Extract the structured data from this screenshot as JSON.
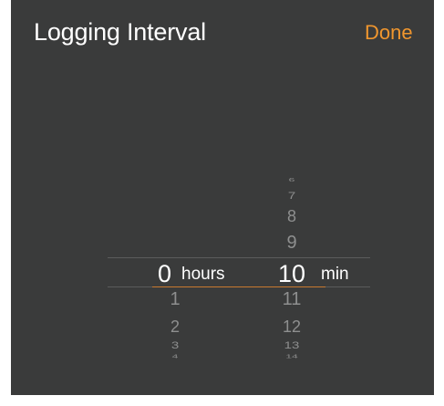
{
  "header": {
    "title": "Logging Interval",
    "done_label": "Done"
  },
  "picker": {
    "hours": {
      "selected": "0",
      "unit": "hours",
      "below": [
        "1",
        "2",
        "3",
        "4"
      ]
    },
    "minutes": {
      "selected": "10",
      "unit": "min",
      "above": [
        "6",
        "7",
        "8",
        "9"
      ],
      "below": [
        "11",
        "12",
        "13",
        "14"
      ]
    }
  },
  "colors": {
    "background": "#3a3b3b",
    "accent": "#f0962e",
    "text": "#ffffff",
    "muted_text": "#8e8f8f"
  }
}
